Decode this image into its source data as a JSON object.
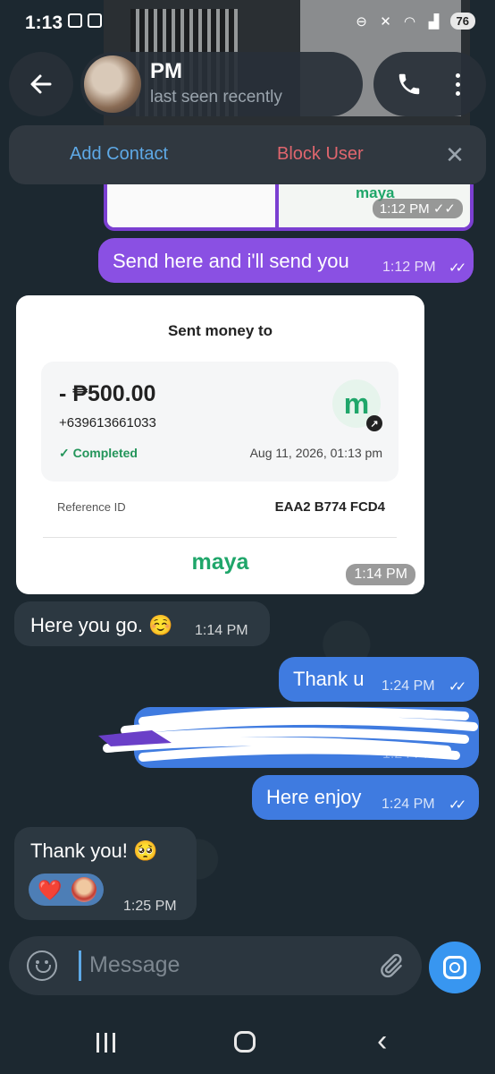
{
  "status_bar": {
    "time": "1:13",
    "battery": "76"
  },
  "header": {
    "contact_name": "PM",
    "contact_status": "last seen recently"
  },
  "contact_bar": {
    "add_contact": "Add Contact",
    "block_user": "Block User",
    "close": "✕"
  },
  "image_message": {
    "logo": "maya",
    "time": "1:12 PM"
  },
  "messages": [
    {
      "text": "Send here and i'll send you",
      "time": "1:12 PM",
      "direction": "out"
    },
    {
      "text": "Here you go. ☺️",
      "time": "1:14 PM",
      "direction": "in"
    },
    {
      "text": "Thank u",
      "time": "1:24 PM",
      "direction": "out"
    },
    {
      "text": "",
      "time": "1:24 PM",
      "direction": "out",
      "redacted": true
    },
    {
      "text": "Here enjoy",
      "time": "1:24 PM",
      "direction": "out"
    },
    {
      "text": "Thank you! 🥺",
      "time": "1:25 PM",
      "direction": "in",
      "reaction": "❤️"
    }
  ],
  "receipt": {
    "title": "Sent money to",
    "amount": "- ₱500.00",
    "phone": "+639613661033",
    "status": "✓  Completed",
    "date": "Aug 11, 2026, 01:13 pm",
    "ref_label": "Reference ID",
    "ref_value": "EAA2 B774 FCD4",
    "brand": "maya",
    "logo_letter": "m",
    "time": "1:14 PM"
  },
  "input": {
    "placeholder": "Message"
  },
  "colors": {
    "outgoing_purple": "#8a50e3",
    "outgoing_blue": "#3f7be0",
    "incoming": "#2c3841",
    "accent": "#3896f0",
    "maya_green": "#1fa66a"
  },
  "icons": [
    "back-arrow-icon",
    "phone-icon",
    "more-vertical-icon",
    "close-icon",
    "emoji-icon",
    "paperclip-icon",
    "camera-icon",
    "read-receipt-icon"
  ]
}
